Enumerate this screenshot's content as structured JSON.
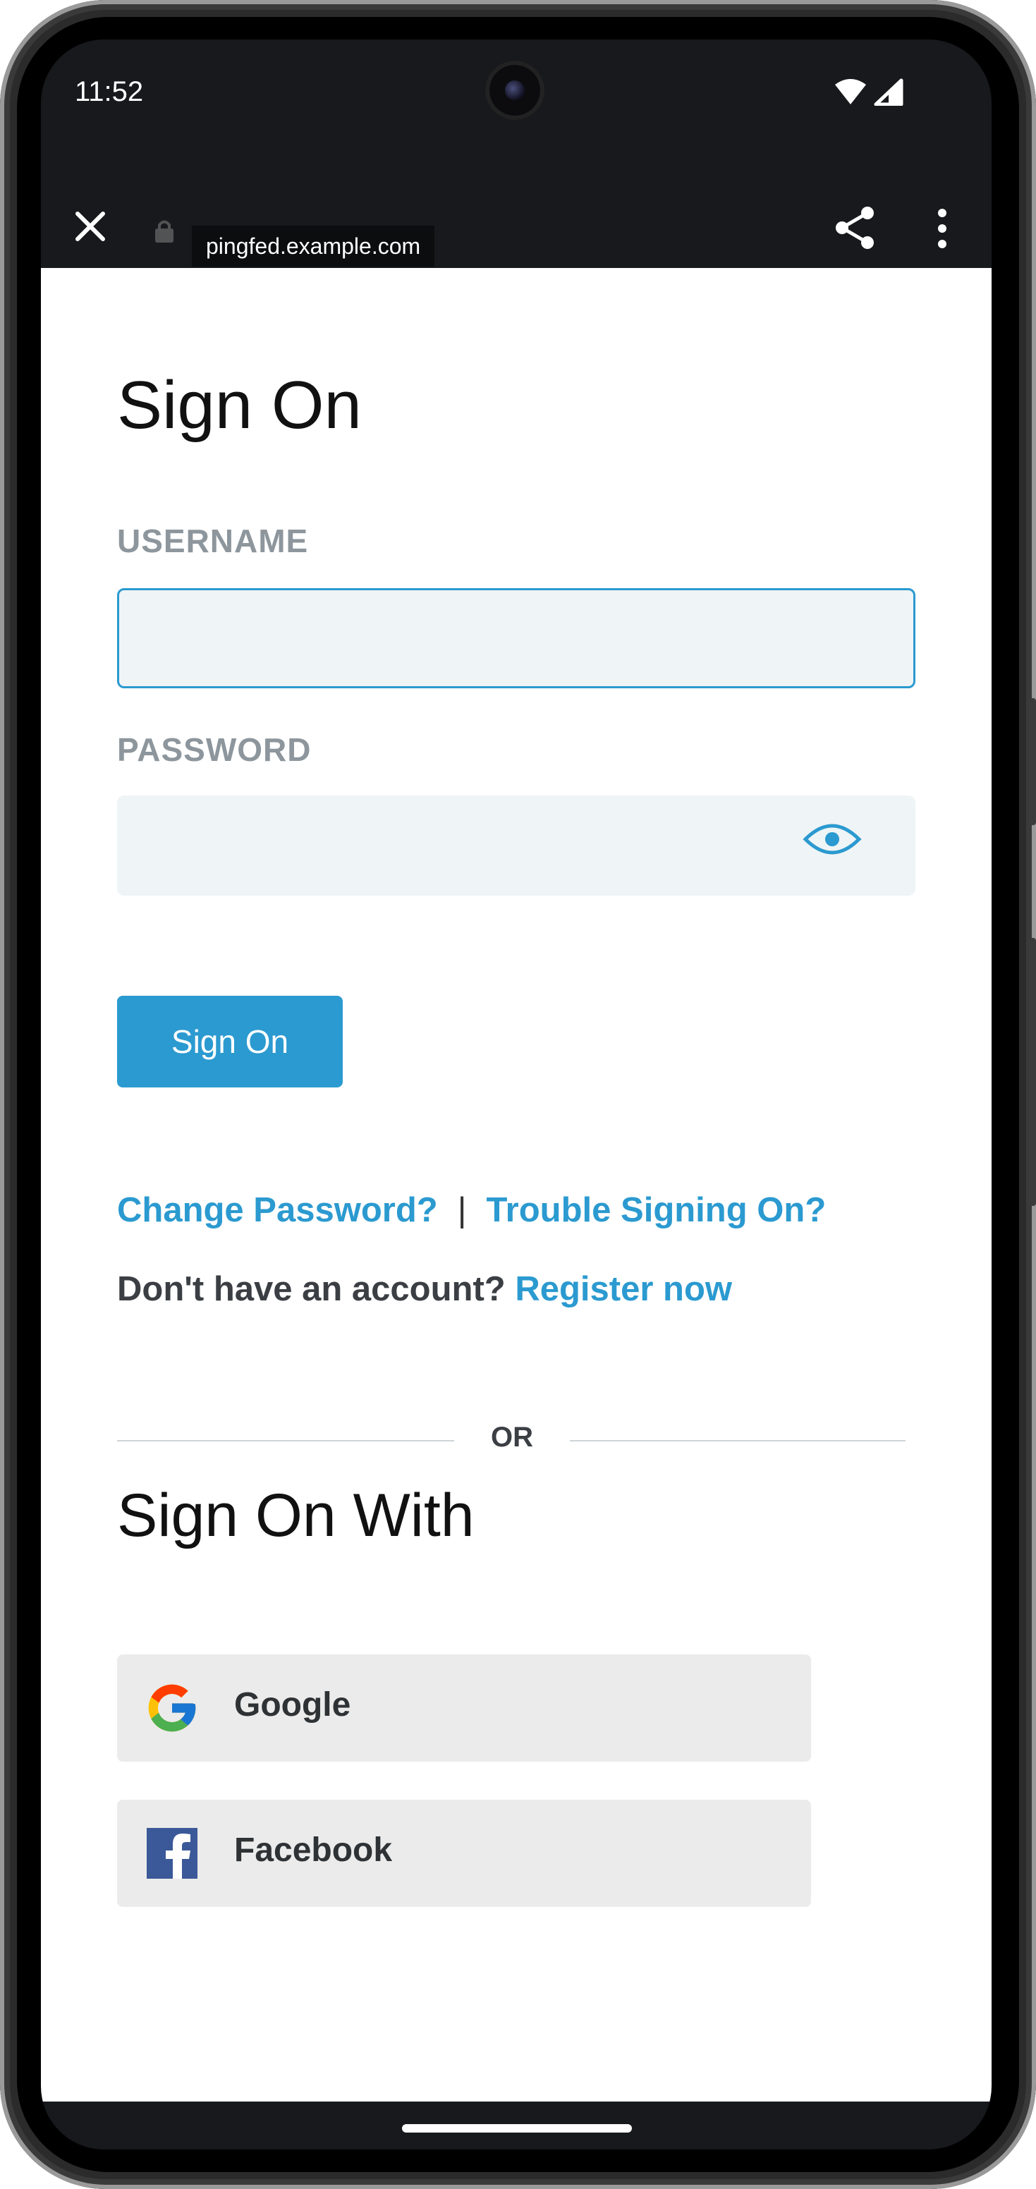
{
  "status_bar": {
    "time": "11:52"
  },
  "browser": {
    "url": "pingfed.example.com"
  },
  "page": {
    "title": "Sign On",
    "username_label": "USERNAME",
    "username_value": "",
    "password_label": "PASSWORD",
    "password_value": "",
    "sign_on_button": "Sign On",
    "change_password_link": "Change Password?",
    "separator": "|",
    "trouble_link": "Trouble Signing On?",
    "no_account_text": "Don't have an account?",
    "register_link": "Register now",
    "or_text": "OR",
    "sign_on_with_title": "Sign On With",
    "providers": [
      {
        "label": "Google",
        "icon": "google-icon"
      },
      {
        "label": "Facebook",
        "icon": "facebook-icon"
      }
    ]
  },
  "colors": {
    "accent": "#2b9ad0",
    "field_bg": "#eff4f6",
    "label": "#8d969c",
    "facebook": "#3b5998",
    "chrome": "#17191c"
  }
}
